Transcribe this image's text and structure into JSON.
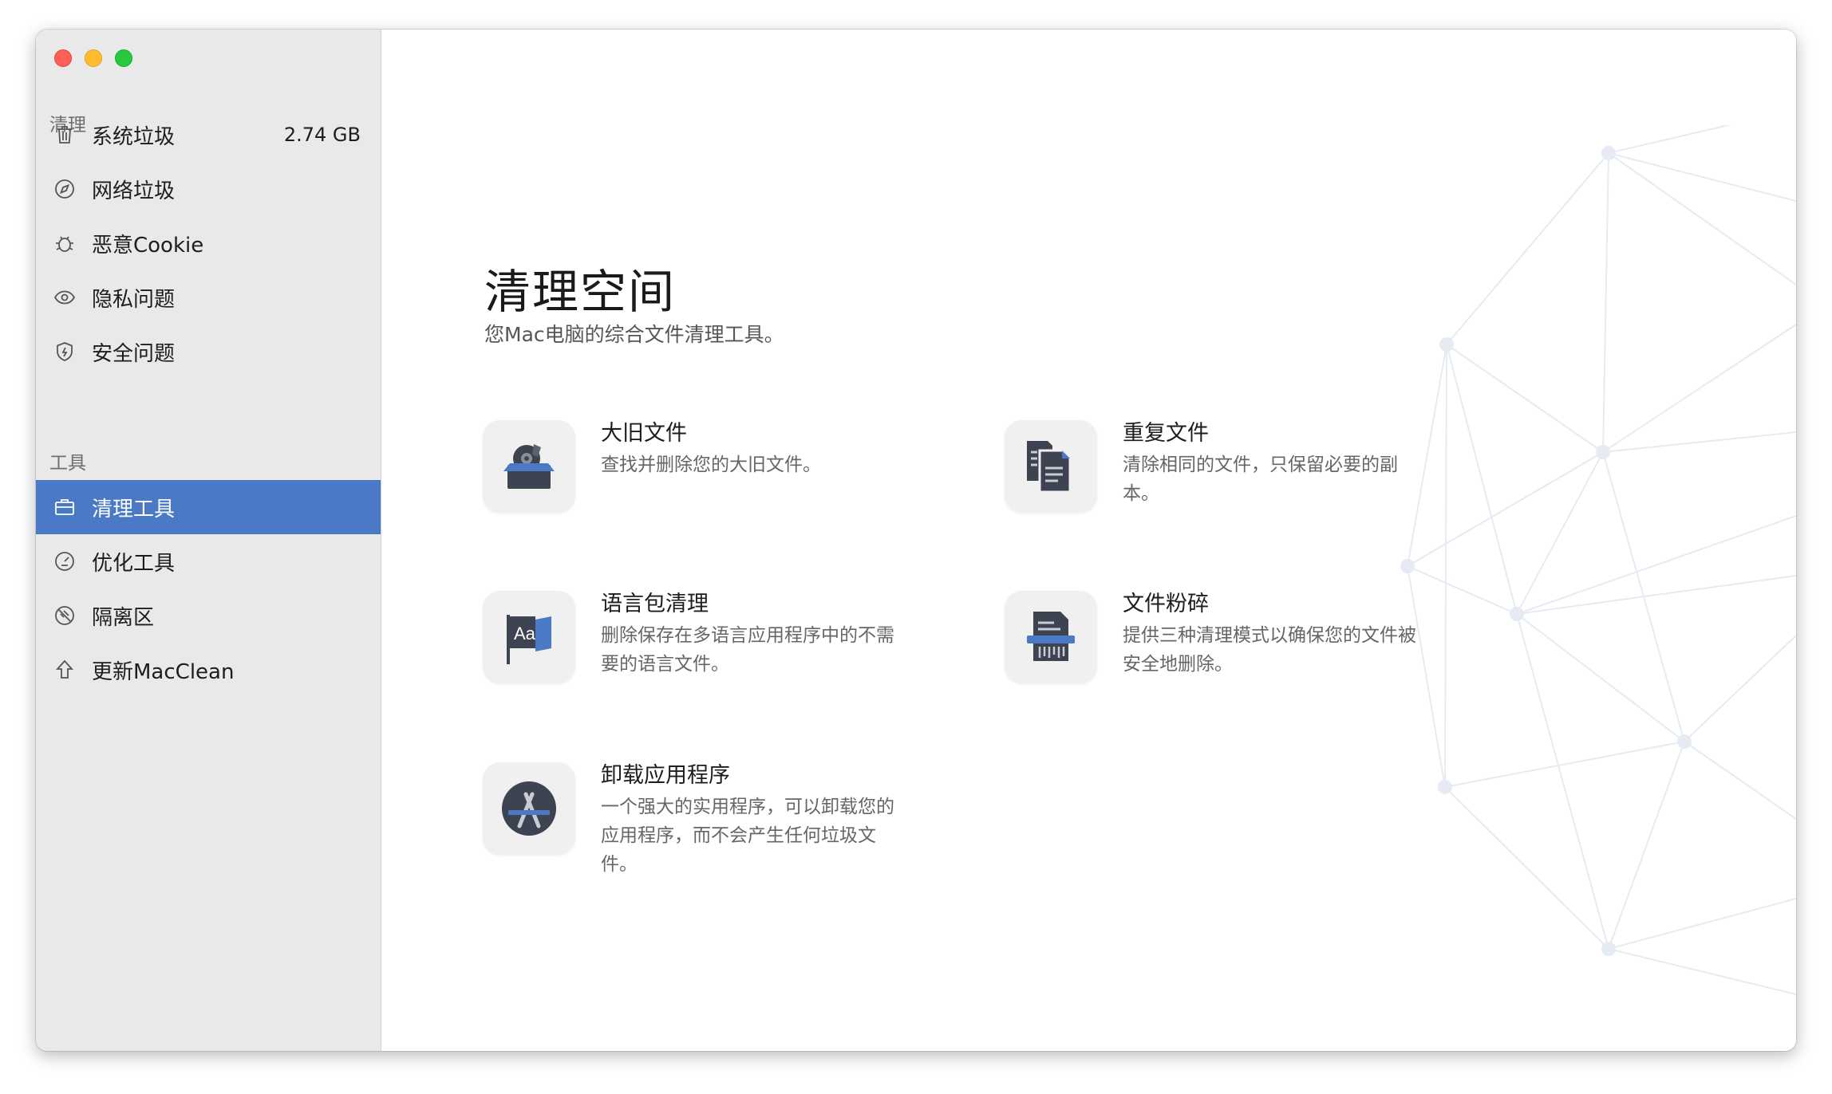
{
  "sidebar": {
    "sections": [
      {
        "label": "清理",
        "items": [
          {
            "label": "系统垃圾",
            "icon": "trash-icon",
            "size": "2.74 GB"
          },
          {
            "label": "网络垃圾",
            "icon": "compass-icon"
          },
          {
            "label": "恶意Cookie",
            "icon": "bug-icon"
          },
          {
            "label": "隐私问题",
            "icon": "eye-icon"
          },
          {
            "label": "安全问题",
            "icon": "shield-icon"
          }
        ]
      },
      {
        "label": "工具",
        "items": [
          {
            "label": "清理工具",
            "icon": "toolbox-icon",
            "active": true
          },
          {
            "label": "优化工具",
            "icon": "gauge-icon"
          },
          {
            "label": "隔离区",
            "icon": "quarantine-icon"
          },
          {
            "label": "更新MacClean",
            "icon": "upload-arrow-icon"
          }
        ]
      }
    ]
  },
  "main": {
    "title": "清理空间",
    "subtitle": "您Mac电脑的综合文件清理工具。",
    "tools": [
      {
        "name": "大旧文件",
        "desc": "查找并删除您的大旧文件。",
        "icon": "large-old-files-icon"
      },
      {
        "name": "重复文件",
        "desc": "清除相同的文件，只保留必要的副本。",
        "icon": "duplicate-files-icon"
      },
      {
        "name": "语言包清理",
        "desc": "删除保存在多语言应用程序中的不需要的语言文件。",
        "icon": "language-flag-icon"
      },
      {
        "name": "文件粉碎",
        "desc": "提供三种清理模式以确保您的文件被安全地删除。",
        "icon": "file-shredder-icon"
      },
      {
        "name": "卸载应用程序",
        "desc": "一个强大的实用程序，可以卸载您的应用程序，而不会产生任何垃圾文件。",
        "icon": "uninstaller-icon"
      }
    ]
  },
  "colors": {
    "accent": "#4a79c6",
    "sidebar_bg": "#e9e9e9",
    "icon_dark": "#3d4350"
  }
}
